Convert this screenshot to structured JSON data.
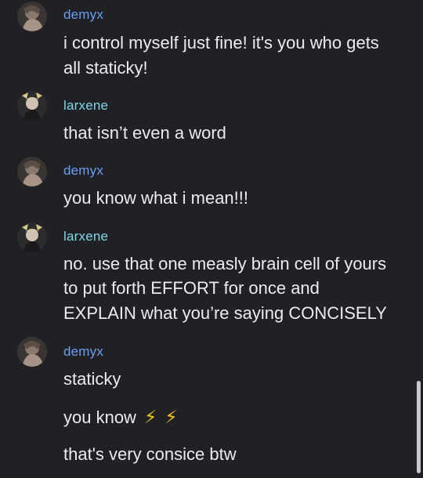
{
  "colors": {
    "background": "#202124",
    "demyx": "#6c9df5",
    "larxene": "#7dd8e8",
    "message_text": "#ececee",
    "emoji": "#f5c518"
  },
  "messages": [
    {
      "author": "demyx",
      "avatar": "demyx-avatar",
      "lines": [
        "i control myself just fine! it's you who gets",
        "all staticky!"
      ]
    },
    {
      "author": "larxene",
      "avatar": "larxene-avatar",
      "lines": [
        "that isn’t even a word"
      ]
    },
    {
      "author": "demyx",
      "avatar": "demyx-avatar",
      "lines": [
        "you know what i mean!!!"
      ]
    },
    {
      "author": "larxene",
      "avatar": "larxene-avatar",
      "lines": [
        "no. use that one measly brain cell of yours",
        "to put forth EFFORT for once and",
        "EXPLAIN what you’re saying CONCISELY"
      ]
    },
    {
      "author": "demyx",
      "avatar": "demyx-avatar",
      "lines": [
        "staticky",
        "you know",
        "that's very consice btw"
      ],
      "emoji": [
        "⚡",
        "⚡"
      ]
    }
  ]
}
